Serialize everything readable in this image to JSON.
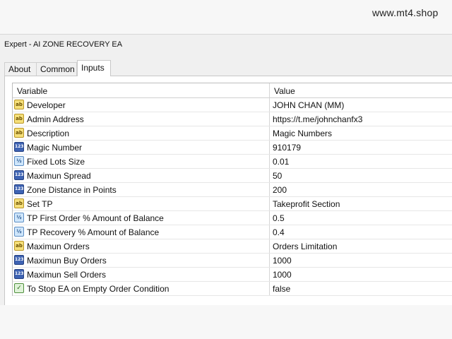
{
  "window": {
    "title": "Expert - AI ZONE RECOVERY EA"
  },
  "watermark": "www.mt4.shop",
  "tabs": [
    "About",
    "Common",
    "Inputs"
  ],
  "table": {
    "columns": [
      "Variable",
      "Value"
    ],
    "rows": [
      {
        "icon": "ab",
        "variable": "Developer",
        "value": "JOHN CHAN (MM)"
      },
      {
        "icon": "ab",
        "variable": "Admin Address",
        "value": "https://t.me/johnchanfx3"
      },
      {
        "icon": "ab",
        "variable": "Description",
        "value": "Magic Numbers"
      },
      {
        "icon": "123",
        "variable": "Magic Number",
        "value": "910179"
      },
      {
        "icon": "v2",
        "variable": "Fixed Lots Size",
        "value": "0.01"
      },
      {
        "icon": "123",
        "variable": "Maximun Spread",
        "value": "50"
      },
      {
        "icon": "123",
        "variable": "Zone Distance in Points",
        "value": "200"
      },
      {
        "icon": "ab",
        "variable": "Set TP",
        "value": "Takeprofit Section"
      },
      {
        "icon": "v2",
        "variable": "TP First Order % Amount of Balance",
        "value": "0.5"
      },
      {
        "icon": "v2",
        "variable": "TP Recovery % Amount of Balance",
        "value": "0.4"
      },
      {
        "icon": "ab",
        "variable": "Maximun Orders",
        "value": "Orders Limitation"
      },
      {
        "icon": "123",
        "variable": "Maximun Buy Orders",
        "value": "1000"
      },
      {
        "icon": "123",
        "variable": "Maximun Sell Orders",
        "value": "1000"
      },
      {
        "icon": "bool",
        "variable": "To Stop EA on Empty Order Condition",
        "value": "false"
      }
    ]
  }
}
